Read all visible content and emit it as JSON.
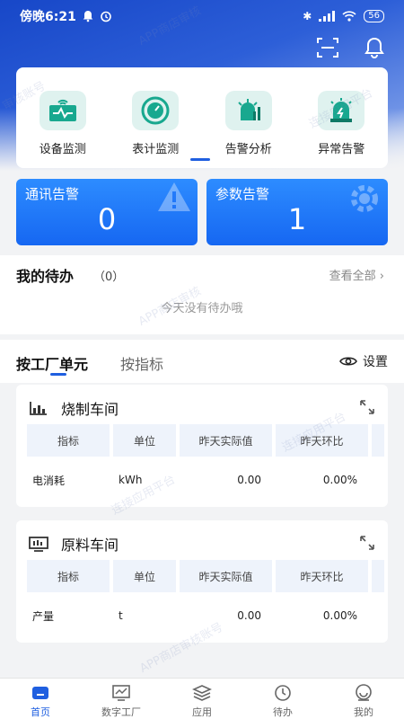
{
  "status_bar": {
    "time": "傍晚6:21",
    "battery": "56"
  },
  "menu": [
    {
      "label": "设备监测",
      "icon": "device-monitor-icon"
    },
    {
      "label": "表计监测",
      "icon": "gauge-icon"
    },
    {
      "label": "告警分析",
      "icon": "alarm-analysis-icon"
    },
    {
      "label": "异常告警",
      "icon": "exception-alarm-icon"
    }
  ],
  "alarms": {
    "comm": {
      "title": "通讯告警",
      "value": "0"
    },
    "param": {
      "title": "参数告警",
      "value": "1"
    }
  },
  "todo": {
    "title": "我的待办",
    "count": "（0）",
    "view_all": "查看全部",
    "empty": "今天没有待办哦"
  },
  "tabs": {
    "by_unit": "按工厂单元",
    "by_indicator": "按指标",
    "settings": "设置"
  },
  "workshops": [
    {
      "name": "烧制车间",
      "headers": [
        "指标",
        "单位",
        "昨天实际值",
        "昨天环比"
      ],
      "rows": [
        {
          "indicator": "电消耗",
          "unit": "kWh",
          "value": "0.00",
          "ratio": "0.00%"
        }
      ]
    },
    {
      "name": "原料车间",
      "headers": [
        "指标",
        "单位",
        "昨天实际值",
        "昨天环比"
      ],
      "rows": [
        {
          "indicator": "产量",
          "unit": "t",
          "value": "0.00",
          "ratio": "0.00%"
        }
      ]
    }
  ],
  "nav": [
    {
      "label": "首页",
      "icon": "home-icon",
      "active": true
    },
    {
      "label": "数字工厂",
      "icon": "digital-factory-icon",
      "active": false
    },
    {
      "label": "应用",
      "icon": "apps-icon",
      "active": false
    },
    {
      "label": "待办",
      "icon": "clock-icon",
      "active": false
    },
    {
      "label": "我的",
      "icon": "profile-icon",
      "active": false
    }
  ],
  "colors": {
    "primary": "#1f5fe0",
    "alarm_card": "#1a6cf5",
    "positive": "#52b36a",
    "menu_icon_bg": "#dff2ef"
  },
  "watermarks": [
    "APP商店审核",
    "连接应用平台",
    "审核账号",
    "APP商店审核账号",
    "连接应用平台"
  ]
}
